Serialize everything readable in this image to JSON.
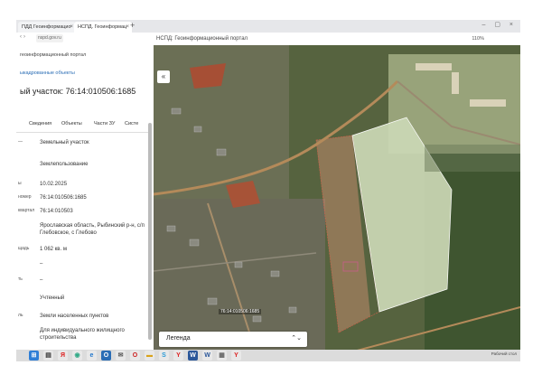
{
  "browser": {
    "tabs": [
      {
        "label": "ПДД Геоинформацио"
      },
      {
        "label": "НСПД. Геоинформац"
      }
    ],
    "url": "nspd.gov.ru",
    "page_title": "НСПД: Геоинформационный портал",
    "zoom": "110%"
  },
  "left_panel": {
    "title": "геоинформационный портал",
    "link": "ыкадрованные объекты",
    "heading": "ый участок: 76:14:010506:1685",
    "tabs": [
      "Сведения",
      "Объекты",
      "Части ЗУ",
      "Систе"
    ],
    "rows": [
      {
        "label": "—",
        "value": "Земельный участок"
      },
      {
        "label": "",
        "value": "Землепользование"
      },
      {
        "label": "ы",
        "value": "10.02.2025"
      },
      {
        "label": "номер",
        "value": "76:14:010506:1685"
      },
      {
        "label": "квартал",
        "value": "76:14:010503"
      },
      {
        "label": "",
        "value": "Ярославская область, Рыбинский р-н, с/п Глебовское, с Глебово"
      },
      {
        "label": "щадь",
        "value": "1 062 кв. м"
      },
      {
        "label": "",
        "value": "–"
      },
      {
        "label": "ть",
        "value": "–"
      },
      {
        "label": "",
        "value": "Учтенный"
      },
      {
        "label": "ль",
        "value": "Земли населенных пунктов"
      },
      {
        "label": "",
        "value": "Для индивидуального жилищного строительства"
      }
    ]
  },
  "map": {
    "legend_label": "Легенда",
    "cadastral_label": "76:14:010506:1685"
  },
  "taskbar": {
    "apps": [
      "windows-icon",
      "explorer-icon",
      "yandex-icon",
      "chrome-icon",
      "ie-icon",
      "outlook-icon",
      "mail-icon",
      "opera-icon",
      "folder-icon",
      "skype-icon",
      "yandex-icon",
      "word-icon",
      "word-icon",
      "paint-icon",
      "yandex-icon"
    ],
    "status_text": "Рабочий стол"
  },
  "colors": {
    "map_field": "#c9d7b2",
    "parcel_red": "#c04a2a",
    "road": "#b48a5a"
  }
}
